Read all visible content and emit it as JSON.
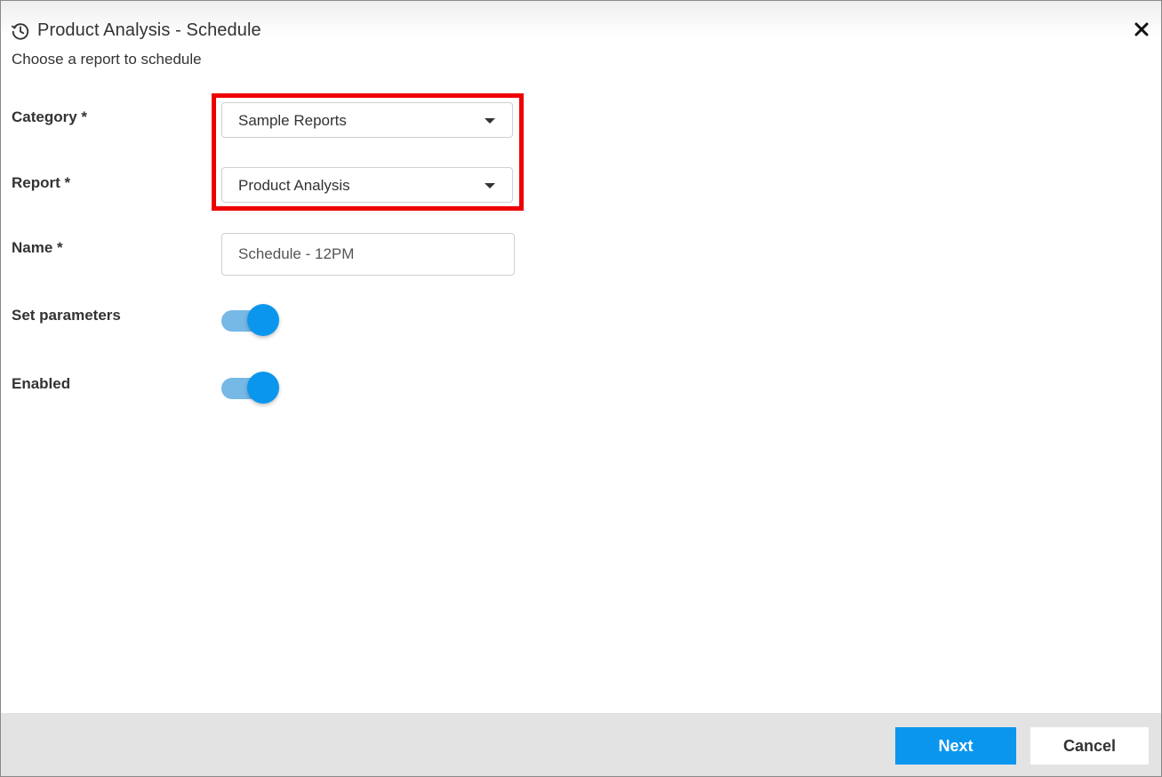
{
  "dialog": {
    "title": "Product Analysis - Schedule",
    "title_icon": "history-clock-icon",
    "close_icon": "close-icon",
    "subtitle": "Choose a report to schedule"
  },
  "form": {
    "category": {
      "label": "Category *",
      "value": "Sample Reports"
    },
    "report": {
      "label": "Report *",
      "value": "Product Analysis"
    },
    "name": {
      "label": "Name *",
      "value": "Schedule - 12PM"
    },
    "set_parameters": {
      "label": "Set parameters",
      "enabled": true
    },
    "enabled": {
      "label": "Enabled",
      "enabled": true
    }
  },
  "footer": {
    "next_label": "Next",
    "cancel_label": "Cancel"
  },
  "colors": {
    "accent": "#0b96ee",
    "toggle_track": "#76b8e6",
    "highlight": "#ee0000",
    "footer_bg": "#e3e3e3"
  }
}
